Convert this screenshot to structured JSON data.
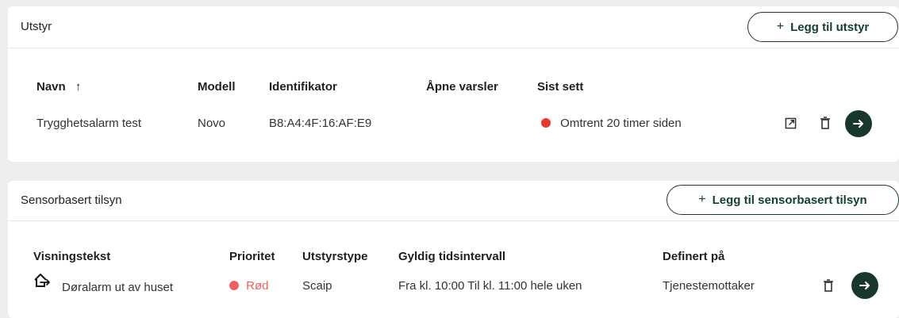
{
  "equipment": {
    "title": "Utstyr",
    "add_button_plus": "+",
    "add_button_label": "Legg til utstyr",
    "columns": {
      "name": "Navn",
      "sort_indicator": "↑",
      "model": "Modell",
      "identifier": "Identifikator",
      "open_alerts": "Åpne varsler",
      "last_seen": "Sist sett"
    },
    "rows": [
      {
        "name": "Trygghetsalarm test",
        "model": "Novo",
        "identifier": "B8:A4:4F:16:AF:E9",
        "open_alerts": "",
        "last_seen": "Omtrent 20 timer siden",
        "status_color": "#e53935"
      }
    ]
  },
  "sensor_supervision": {
    "title": "Sensorbasert tilsyn",
    "add_button_plus": "+",
    "add_button_label": "Legg til sensorbasert tilsyn",
    "columns": {
      "display_text": "Visningstekst",
      "priority": "Prioritet",
      "equipment_type": "Utstyrstype",
      "valid_interval": "Gyldig tidsintervall",
      "defined_on": "Definert på"
    },
    "rows": [
      {
        "icon": "house-exit-icon",
        "display_text": "Døralarm ut av huset",
        "priority": "Rød",
        "priority_color": "#f06060",
        "equipment_type": "Scaip",
        "valid_interval": "Fra kl. 10:00 Til kl. 11:00 hele uken",
        "defined_on": "Tjenestemottaker"
      }
    ]
  },
  "colors": {
    "accent": "#17382a",
    "background": "#ededed",
    "card": "#ffffff"
  }
}
